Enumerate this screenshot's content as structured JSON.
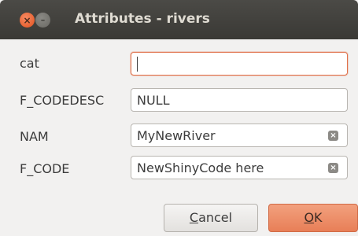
{
  "window": {
    "title": "Attributes - rivers"
  },
  "fields": [
    {
      "label": "cat",
      "value": ""
    },
    {
      "label": "F_CODEDESC",
      "value": "NULL"
    },
    {
      "label": "NAM",
      "value": "MyNewRiver"
    },
    {
      "label": "F_CODE",
      "value": "NewShinyCode here"
    }
  ],
  "buttons": {
    "cancel_accel": "C",
    "cancel_rest": "ancel",
    "ok_accel": "O",
    "ok_rest": "K"
  },
  "icons": {
    "close": "close-icon",
    "minimize": "minimize-icon",
    "clear": "clear-icon"
  },
  "colors": {
    "accent": "#e87f57",
    "titlebar": "#3c3b37",
    "background": "#f2f1f0"
  }
}
